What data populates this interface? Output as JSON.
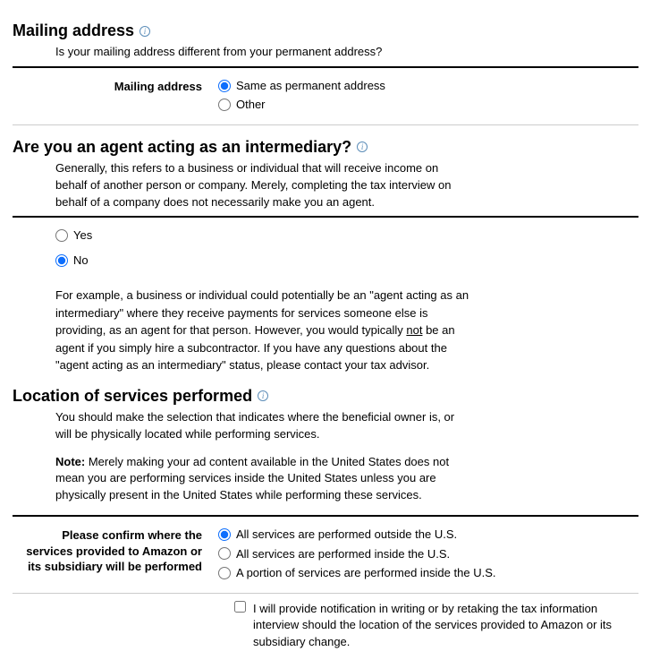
{
  "section1": {
    "heading": "Mailing address",
    "desc": "Is your mailing address different from your permanent address?",
    "field_label": "Mailing address",
    "options": {
      "same": "Same as permanent address",
      "other": "Other"
    }
  },
  "section2": {
    "heading": "Are you an agent acting as an intermediary?",
    "desc": "Generally, this refers to a business or individual that will receive income on behalf of another person or company. Merely, completing the tax interview on behalf of a company does not necessarily make you an agent.",
    "options": {
      "yes": "Yes",
      "no": "No"
    },
    "example_pre": "For example, a business or individual could potentially be an \"agent acting as an intermediary\" where they receive payments for services someone else is providing, as an agent for that person. However, you would typically ",
    "example_not": "not",
    "example_post": " be an agent if you simply hire a subcontractor. If you have any questions about the \"agent acting as an intermediary\" status, please contact your tax advisor."
  },
  "section3": {
    "heading": "Location of services performed",
    "desc1": "You should make the selection that indicates where the beneficial owner is, or will be physically located while performing services.",
    "note_label": "Note:",
    "desc2": " Merely making your ad content available in the United States does not mean you are performing services inside the United States unless you are physically present in the United States while performing these services.",
    "field_label": "Please confirm where the services provided to Amazon or its subsidiary will be performed",
    "options": {
      "outside": "All services are performed outside the U.S.",
      "inside": "All services are performed inside the U.S.",
      "portion": "A portion of services are performed inside the U.S."
    },
    "checkbox_label": "I will provide notification in writing or by retaking the tax information interview should the location of the services provided to Amazon or its subsidiary change."
  }
}
